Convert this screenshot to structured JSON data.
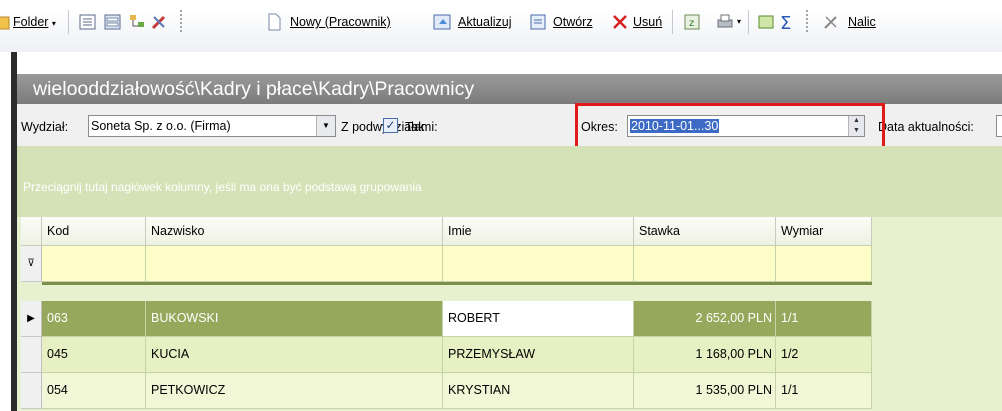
{
  "toolbar": {
    "folder_label": "Folder",
    "new_label": "Nowy (Pracownik)",
    "update_label": "Aktualizuj",
    "open_label": "Otwórz",
    "delete_label": "Usuń",
    "calc_label": "Nalic"
  },
  "breadcrumb": "wielooddziałowość\\Kadry i płace\\Kadry\\Pracownicy",
  "filters": {
    "department_label": "Wydział:",
    "department_value": "Soneta Sp. z o.o. (Firma)",
    "subdepartments_label": "Z podwydziałami:",
    "subdepartments_value": "Tak",
    "period_label": "Okres:",
    "period_value": "2010-11-01...30",
    "date_label": "Data aktualności:"
  },
  "grouping_hint": "Przeciągnij tutaj nagłówek kolumny, jeśli ma ona być podstawą grupowania",
  "columns": [
    "Kod",
    "Nazwisko",
    "Imie",
    "Stawka",
    "Wymiar"
  ],
  "rows": [
    {
      "kod": "063",
      "nazwisko": "BUKOWSKI",
      "imie": "ROBERT",
      "stawka": "2 652,00 PLN",
      "wymiar": "1/1"
    },
    {
      "kod": "045",
      "nazwisko": "KUCIA",
      "imie": "PRZEMYSŁAW",
      "stawka": "1 168,00 PLN",
      "wymiar": "1/2"
    },
    {
      "kod": "054",
      "nazwisko": "PETKOWICZ",
      "imie": "KRYSTIAN",
      "stawka": "1 535,00 PLN",
      "wymiar": "1/1"
    }
  ],
  "colors": {
    "highlight_box": "#e11a1a",
    "selected_row": "#95a85b",
    "row_bg": "#e6f0c2",
    "group_panel": "#d5e2b7"
  }
}
